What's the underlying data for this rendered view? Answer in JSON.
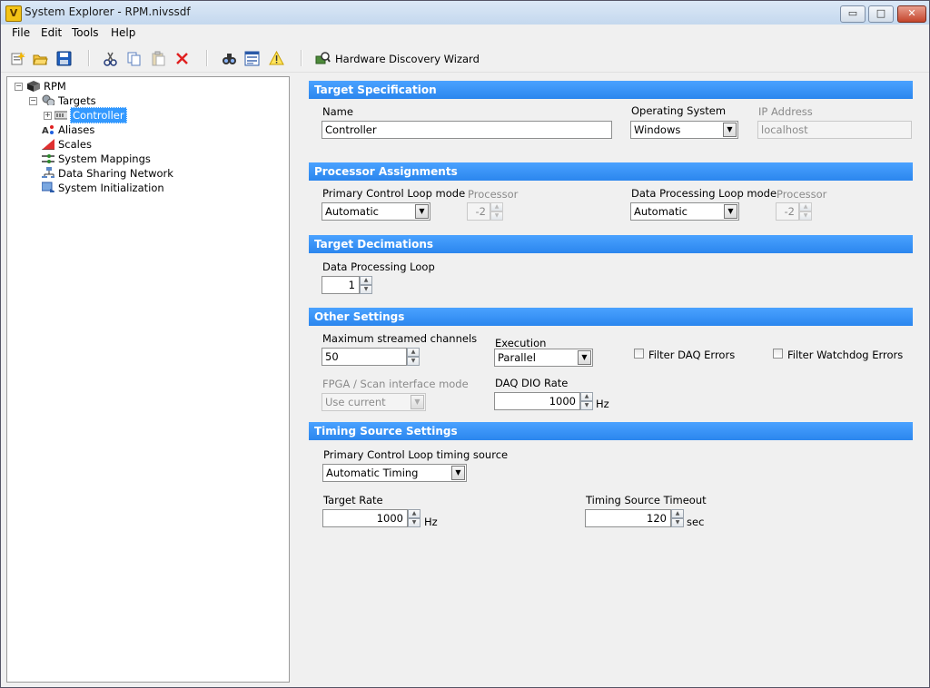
{
  "window": {
    "title": "System Explorer - RPM.nivssdf",
    "app_icon_letter": "V"
  },
  "window_controls": {
    "minimize": "▭",
    "maximize": "□",
    "close": "✕"
  },
  "menu": [
    "File",
    "Edit",
    "Tools",
    "Help"
  ],
  "toolbar": {
    "icons": [
      "new-icon",
      "open-icon",
      "save-icon",
      "cut-icon",
      "copy-icon",
      "paste-icon",
      "delete-icon",
      "find-icon",
      "properties-icon",
      "warning-icon",
      "hardware-discovery-icon"
    ],
    "wizard_label": "Hardware Discovery Wizard"
  },
  "tree": {
    "root": "RPM",
    "targets": "Targets",
    "controller": "Controller",
    "items": [
      "Aliases",
      "Scales",
      "System Mappings",
      "Data Sharing Network",
      "System Initialization"
    ]
  },
  "target_spec": {
    "header": "Target Specification",
    "name_label": "Name",
    "name_value": "Controller",
    "os_label": "Operating System",
    "os_value": "Windows",
    "ip_label": "IP Address",
    "ip_value": "localhost"
  },
  "processor": {
    "header": "Processor Assignments",
    "pcl_mode_label": "Primary Control Loop mode",
    "pcl_mode_value": "Automatic",
    "processor_label": "Processor",
    "processor_value": "-2",
    "dpl_mode_label": "Data Processing Loop mode",
    "dpl_mode_value": "Automatic",
    "processor2_label": "Processor",
    "processor2_value": "-2"
  },
  "decimations": {
    "header": "Target Decimations",
    "dpl_label": "Data Processing Loop",
    "dpl_value": "1"
  },
  "other": {
    "header": "Other Settings",
    "max_channels_label": "Maximum streamed channels",
    "max_channels_value": "50",
    "execution_label": "Execution",
    "execution_value": "Parallel",
    "filter_daq_label": "Filter DAQ Errors",
    "filter_watchdog_label": "Filter Watchdog Errors",
    "fpga_label": "FPGA / Scan interface mode",
    "fpga_value": "Use current",
    "dio_rate_label": "DAQ DIO Rate",
    "dio_rate_value": "1000",
    "dio_rate_unit": "Hz"
  },
  "timing": {
    "header": "Timing Source Settings",
    "source_label": "Primary Control Loop timing source",
    "source_value": "Automatic Timing",
    "rate_label": "Target Rate",
    "rate_value": "1000",
    "rate_unit": "Hz",
    "timeout_label": "Timing Source Timeout",
    "timeout_value": "120",
    "timeout_unit": "sec"
  }
}
